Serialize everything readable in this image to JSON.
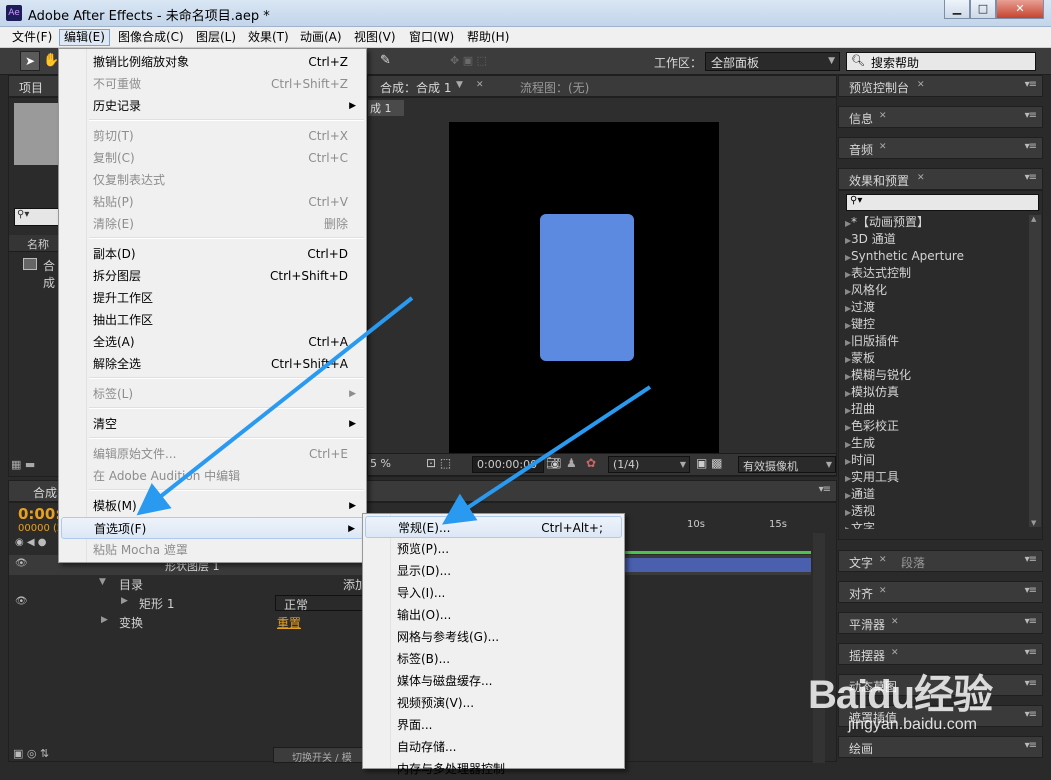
{
  "window": {
    "title": "Adobe After Effects - 未命名项目.aep *",
    "app_icon": "Ae"
  },
  "menubar": [
    "文件(F)",
    "编辑(E)",
    "图像合成(C)",
    "图层(L)",
    "效果(T)",
    "动画(A)",
    "视图(V)",
    "窗口(W)",
    "帮助(H)"
  ],
  "toolbar": {
    "workspace_label": "工作区：",
    "workspace_value": "全部面板",
    "search_placeholder": "搜索帮助"
  },
  "project_panel": {
    "title": "项目",
    "column_name": "名称",
    "item": "合成"
  },
  "comp_panel": {
    "tab": "合成：合成 1",
    "flow_tab": "流程图：(无)",
    "breadcrumb": "成 1",
    "zoom": "5 %",
    "timecode": "0:00:00:00",
    "resolution": "(1/4)",
    "camera": "有效摄像机"
  },
  "timeline": {
    "tab": "合成",
    "timecode": "0:00:",
    "frames": "00000 (2",
    "ruler": [
      "10s",
      "15s"
    ],
    "layer_name": "形状图层 1",
    "rows": [
      {
        "label": "目录",
        "value": "添加"
      },
      {
        "label": "矩形 1",
        "value": "正常"
      },
      {
        "label": "变换",
        "value": "重置"
      }
    ],
    "footer": "切换开关 / 模"
  },
  "right_panels": {
    "preview": "预览控制台",
    "info": "信息",
    "audio": "音频",
    "effects": "效果和预置",
    "effects_list": [
      "*【动画预置】",
      "3D 通道",
      "Synthetic Aperture",
      "表达式控制",
      "风格化",
      "过渡",
      "键控",
      "旧版插件",
      "蒙板",
      "模糊与锐化",
      "模拟仿真",
      "扭曲",
      "色彩校正",
      "生成",
      "时间",
      "实用工具",
      "通道",
      "透视",
      "文字"
    ],
    "text": "文字",
    "paragraph": "段落",
    "align": "对齐",
    "smoother": "平滑器",
    "wiggler": "摇摆器",
    "motion_sketch": "动态草图",
    "mask_interp": "遮罩插值",
    "paint": "绘画"
  },
  "edit_menu": [
    {
      "label": "撤销比例缩放对象",
      "shortcut": "Ctrl+Z",
      "disabled": false
    },
    {
      "label": "不可重做",
      "shortcut": "Ctrl+Shift+Z",
      "disabled": true
    },
    {
      "label": "历史记录",
      "shortcut": "",
      "disabled": false,
      "submenu": true
    },
    {
      "label": "剪切(T)",
      "shortcut": "Ctrl+X",
      "disabled": true
    },
    {
      "label": "复制(C)",
      "shortcut": "Ctrl+C",
      "disabled": true
    },
    {
      "label": "仅复制表达式",
      "shortcut": "",
      "disabled": true
    },
    {
      "label": "粘贴(P)",
      "shortcut": "Ctrl+V",
      "disabled": true
    },
    {
      "label": "清除(E)",
      "shortcut": "删除",
      "disabled": true
    },
    {
      "label": "副本(D)",
      "shortcut": "Ctrl+D",
      "disabled": false
    },
    {
      "label": "拆分图层",
      "shortcut": "Ctrl+Shift+D",
      "disabled": false
    },
    {
      "label": "提升工作区",
      "shortcut": "",
      "disabled": false
    },
    {
      "label": "抽出工作区",
      "shortcut": "",
      "disabled": false
    },
    {
      "label": "全选(A)",
      "shortcut": "Ctrl+A",
      "disabled": false
    },
    {
      "label": "解除全选",
      "shortcut": "Ctrl+Shift+A",
      "disabled": false
    },
    {
      "label": "标签(L)",
      "shortcut": "",
      "disabled": true,
      "submenu": true
    },
    {
      "label": "清空",
      "shortcut": "",
      "disabled": false,
      "submenu": true
    },
    {
      "label": "编辑原始文件...",
      "shortcut": "Ctrl+E",
      "disabled": true
    },
    {
      "label": "在 Adobe Audition 中编辑",
      "shortcut": "",
      "disabled": true
    },
    {
      "label": "模板(M)",
      "shortcut": "",
      "disabled": false,
      "submenu": true
    },
    {
      "label": "首选项(F)",
      "shortcut": "",
      "disabled": false,
      "submenu": true,
      "highlighted": true
    },
    {
      "label": "粘贴 Mocha 遮罩",
      "shortcut": "",
      "disabled": true
    }
  ],
  "preferences_submenu": [
    {
      "label": "常规(E)...",
      "shortcut": "Ctrl+Alt+;"
    },
    {
      "label": "预览(P)..."
    },
    {
      "label": "显示(D)..."
    },
    {
      "label": "导入(I)..."
    },
    {
      "label": "输出(O)..."
    },
    {
      "label": "网格与参考线(G)..."
    },
    {
      "label": "标签(B)..."
    },
    {
      "label": "媒体与磁盘缓存..."
    },
    {
      "label": "视频预演(V)..."
    },
    {
      "label": "界面..."
    },
    {
      "label": "自动存储..."
    },
    {
      "label": "内存与多处理器控制"
    }
  ],
  "watermark": {
    "brand": "Baidu经验",
    "url": "jingyan.baidu.com"
  },
  "colors": {
    "shape_fill": "#5b8ae0",
    "arrow": "#2a9af0",
    "layer_bar": "#4a5fae",
    "timecode": "#e8a020"
  }
}
